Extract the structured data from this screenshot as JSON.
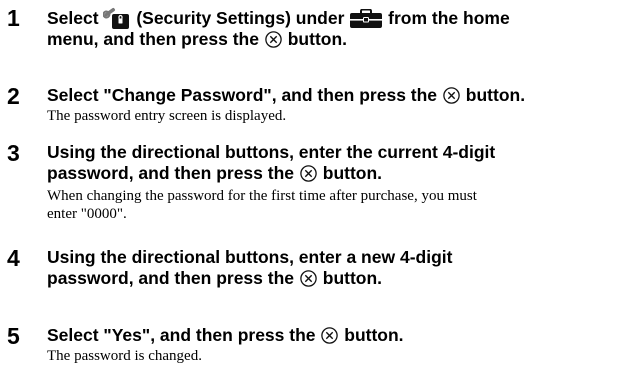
{
  "steps": [
    {
      "number": "1",
      "parts": [
        "Select",
        "(Security Settings) under",
        "from the home",
        "menu, and then press the",
        "button."
      ],
      "icons": [
        "security-settings-icon",
        "toolbox-category-icon",
        "cross-button-icon"
      ]
    },
    {
      "number": "2",
      "parts": [
        "Select \"Change Password\", and then press the",
        "button."
      ],
      "description": [
        "The password entry screen is displayed."
      ],
      "icons": [
        "cross-button-icon"
      ]
    },
    {
      "number": "3",
      "parts": [
        "Using the directional buttons, enter the current 4-digit",
        "password, and then press the",
        "button."
      ],
      "description": [
        "When changing the password for the first time after purchase, you must",
        "enter \"0000\"."
      ],
      "icons": [
        "cross-button-icon"
      ]
    },
    {
      "number": "4",
      "parts": [
        "Using the directional buttons, enter a new 4-digit",
        "password, and then press the",
        "button."
      ],
      "icons": [
        "cross-button-icon"
      ]
    },
    {
      "number": "5",
      "parts": [
        "Select \"Yes\", and then press the",
        "button."
      ],
      "description": [
        "The password is changed."
      ],
      "icons": [
        "cross-button-icon"
      ]
    }
  ],
  "colors": {
    "text": "#000000",
    "icon_dark": "#111111",
    "icon_accent": "#c0392b"
  }
}
